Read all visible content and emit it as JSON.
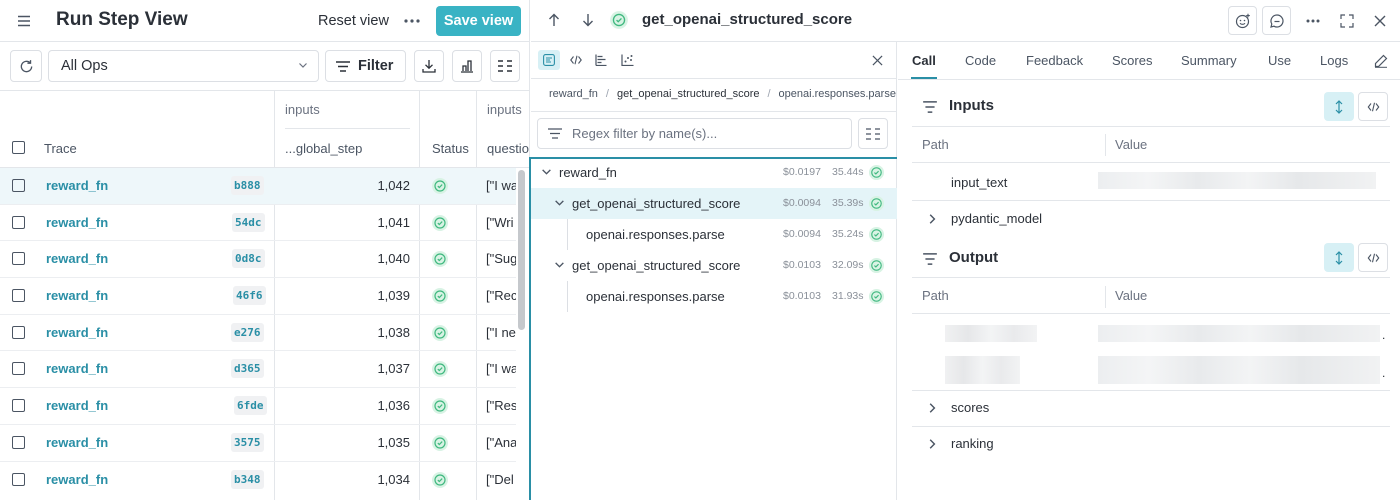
{
  "left": {
    "title": "Run Step View",
    "reset_label": "Reset view",
    "save_label": "Save view",
    "ops_select_value": "All Ops",
    "filter_label": "Filter",
    "table": {
      "group_inputs_1": "inputs",
      "group_inputs_2": "inputs",
      "col_trace": "Trace",
      "col_global_step": "...global_step",
      "col_status": "Status",
      "col_question": "questio",
      "rows": [
        {
          "trace": "reward_fn",
          "hash": "b888",
          "step": "1,042",
          "question": "[\"I wa"
        },
        {
          "trace": "reward_fn",
          "hash": "54dc",
          "step": "1,041",
          "question": "[\"Wri"
        },
        {
          "trace": "reward_fn",
          "hash": "0d8c",
          "step": "1,040",
          "question": "[\"Sug"
        },
        {
          "trace": "reward_fn",
          "hash": "46f6",
          "step": "1,039",
          "question": "[\"Rec"
        },
        {
          "trace": "reward_fn",
          "hash": "e276",
          "step": "1,038",
          "question": "[\"I ne"
        },
        {
          "trace": "reward_fn",
          "hash": "d365",
          "step": "1,037",
          "question": "[\"I wa"
        },
        {
          "trace": "reward_fn",
          "hash": "6fde",
          "step": "1,036",
          "question": "[\"Res"
        },
        {
          "trace": "reward_fn",
          "hash": "3575",
          "step": "1,035",
          "question": "[\"Ana"
        },
        {
          "trace": "reward_fn",
          "hash": "b348",
          "step": "1,034",
          "question": "[\"Del"
        }
      ]
    }
  },
  "header": {
    "call_title": "get_openai_structured_score"
  },
  "trace_panel": {
    "breadcrumbs": [
      "reward_fn",
      "get_openai_structured_score",
      "openai.responses.parse"
    ],
    "regex_placeholder": "Regex filter by name(s)...",
    "nodes": [
      {
        "name": "reward_fn",
        "cost": "$0.0197",
        "duration": "35.44s"
      },
      {
        "name": "get_openai_structured_score",
        "cost": "$0.0094",
        "duration": "35.39s"
      },
      {
        "name": "openai.responses.parse",
        "cost": "$0.0094",
        "duration": "35.24s"
      },
      {
        "name": "get_openai_structured_score",
        "cost": "$0.0103",
        "duration": "32.09s"
      },
      {
        "name": "openai.responses.parse",
        "cost": "$0.0103",
        "duration": "31.93s"
      }
    ]
  },
  "detail": {
    "tabs": [
      "Call",
      "Code",
      "Feedback",
      "Scores",
      "Summary",
      "Use",
      "Logs"
    ],
    "active_tab": "Call",
    "inputs": {
      "title": "Inputs",
      "col_path": "Path",
      "col_value": "Value",
      "rows": [
        "input_text",
        "pydantic_model"
      ]
    },
    "output": {
      "title": "Output",
      "col_path": "Path",
      "col_value": "Value",
      "rows": [
        "scores",
        "ranking"
      ]
    }
  },
  "colors": {
    "accent": "#39b3c4",
    "link": "#2a8fa6",
    "success": "#3fb87f"
  }
}
